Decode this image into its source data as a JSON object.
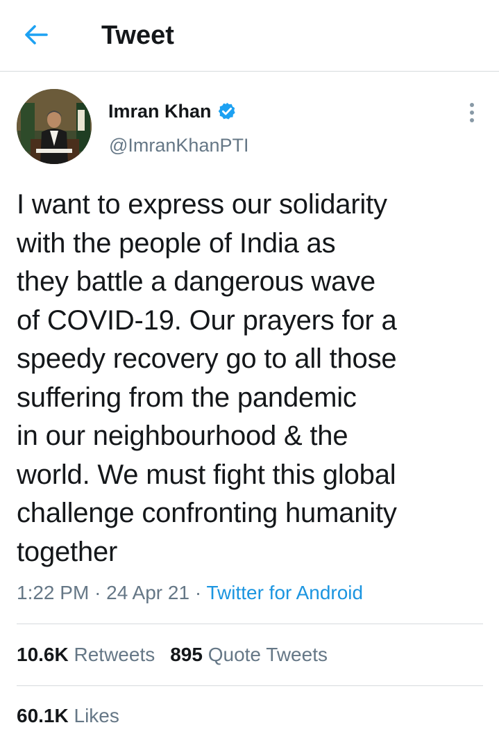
{
  "header": {
    "title": "Tweet",
    "back_icon": "back-arrow-icon",
    "accent_color": "#1da1f2"
  },
  "author": {
    "display_name": "Imran Khan",
    "handle": "@ImranKhanPTI",
    "verified": true,
    "verified_icon": "verified-badge-icon",
    "avatar_icon": "avatar-image"
  },
  "tweet": {
    "text": "I want to express our solidarity\nwith the people of India as\nthey battle a dangerous wave\nof COVID-19. Our prayers for a\nspeedy recovery go to all those\nsuffering from the pandemic\nin our neighbourhood & the\nworld. We must fight this global\nchallenge confronting humanity\ntogether",
    "time": "1:22 PM",
    "separator": "·",
    "date": "24 Apr 21",
    "source": "Twitter for Android",
    "more_icon": "more-vertical-icon"
  },
  "stats": {
    "retweets_count": "10.6K",
    "retweets_label": "Retweets",
    "quotes_count": "895",
    "quotes_label": "Quote Tweets",
    "likes_count": "60.1K",
    "likes_label": "Likes"
  }
}
